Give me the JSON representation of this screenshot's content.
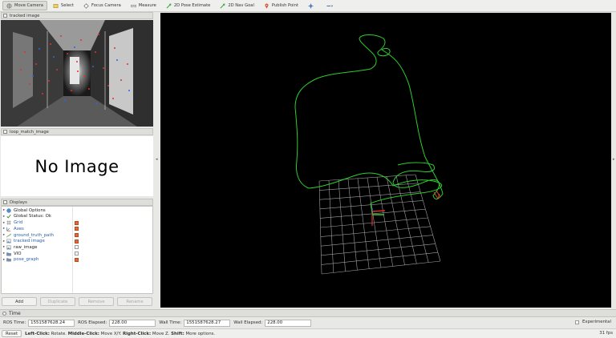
{
  "toolbar": {
    "tools": [
      {
        "label": "Move Camera",
        "icon": "move-camera-icon",
        "active": true
      },
      {
        "label": "Select",
        "icon": "select-icon",
        "active": false
      },
      {
        "label": "Focus Camera",
        "icon": "focus-camera-icon",
        "active": false
      },
      {
        "label": "Measure",
        "icon": "measure-icon",
        "active": false
      },
      {
        "label": "2D Pose Estimate",
        "icon": "pose-estimate-icon",
        "active": false
      },
      {
        "label": "2D Nav Goal",
        "icon": "nav-goal-icon",
        "active": false
      },
      {
        "label": "Publish Point",
        "icon": "publish-point-icon",
        "active": false
      }
    ]
  },
  "panels": {
    "tracked_image": {
      "title": "tracked image"
    },
    "loop_match_image": {
      "title": "loop_match_image",
      "placeholder": "No Image"
    },
    "displays": {
      "title": "Displays"
    }
  },
  "displays": {
    "items": [
      {
        "label": "Global Options",
        "icon": "globe-icon",
        "check": null,
        "plugin": false
      },
      {
        "label": "Global Status: Ok",
        "icon": "checkmark-icon",
        "check": null,
        "plugin": false
      },
      {
        "label": "Grid",
        "icon": "grid-icon",
        "check": true,
        "plugin": true
      },
      {
        "label": "Axes",
        "icon": "axes-icon",
        "check": true,
        "plugin": true
      },
      {
        "label": "ground_truth_path",
        "icon": "path-icon",
        "check": true,
        "plugin": true
      },
      {
        "label": "tracked image",
        "icon": "image-icon",
        "check": true,
        "plugin": true
      },
      {
        "label": "raw_image",
        "icon": "image-icon",
        "check": false,
        "plugin": false
      },
      {
        "label": "VIO",
        "icon": "folder-icon",
        "check": false,
        "plugin": false
      },
      {
        "label": "pose_graph",
        "icon": "folder-icon",
        "check": true,
        "plugin": true
      }
    ],
    "buttons": {
      "add": "Add",
      "duplicate": "Duplicate",
      "remove": "Remove",
      "rename": "Rename"
    }
  },
  "time": {
    "title": "Time",
    "ros_time_label": "ROS Time:",
    "ros_time": "1551587628.24",
    "ros_elapsed_label": "ROS Elapsed:",
    "ros_elapsed": "228.00",
    "wall_time_label": "Wall Time:",
    "wall_time": "1551587628.27",
    "wall_elapsed_label": "Wall Elapsed:",
    "wall_elapsed": "228.00",
    "experimental_label": "Experimental"
  },
  "status": {
    "reset": "Reset",
    "hint_parts": [
      {
        "bold": true,
        "text": "Left-Click:"
      },
      {
        "bold": false,
        "text": " Rotate. "
      },
      {
        "bold": true,
        "text": "Middle-Click:"
      },
      {
        "bold": false,
        "text": " Move X/Y. "
      },
      {
        "bold": true,
        "text": "Right-Click:"
      },
      {
        "bold": false,
        "text": " Move Z. "
      },
      {
        "bold": true,
        "text": "Shift:"
      },
      {
        "bold": false,
        "text": " More options."
      }
    ],
    "fps": "31 fps"
  },
  "colors": {
    "trajectory": "#2ecc2e",
    "grid": "#a0a0a0",
    "checkbox_on": "#e06a3a",
    "plugin_text": "#2b5fa8"
  }
}
